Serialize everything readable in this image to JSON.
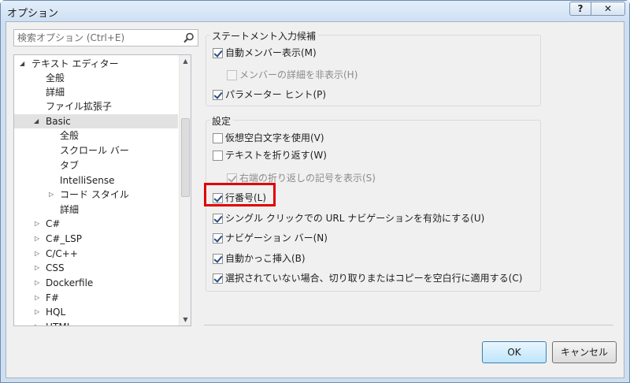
{
  "window": {
    "title": "オプション",
    "help_label": "?",
    "close_label": "✕"
  },
  "search": {
    "placeholder": "検索オプション (Ctrl+E)",
    "icon": "search-icon"
  },
  "tree": {
    "items": [
      {
        "label": "テキスト エディター",
        "expander": "expanded"
      },
      {
        "label": "全般"
      },
      {
        "label": "詳細"
      },
      {
        "label": "ファイル拡張子"
      },
      {
        "label": "Basic",
        "expander": "expanded",
        "selected": true
      },
      {
        "label": "全般"
      },
      {
        "label": "スクロール バー"
      },
      {
        "label": "タブ"
      },
      {
        "label": "IntelliSense"
      },
      {
        "label": "コード スタイル",
        "expander": "collapsed"
      },
      {
        "label": "詳細"
      },
      {
        "label": "C#",
        "expander": "collapsed"
      },
      {
        "label": "C#_LSP",
        "expander": "collapsed"
      },
      {
        "label": "C/C++",
        "expander": "collapsed"
      },
      {
        "label": "CSS",
        "expander": "collapsed"
      },
      {
        "label": "Dockerfile",
        "expander": "collapsed"
      },
      {
        "label": "F#",
        "expander": "collapsed"
      },
      {
        "label": "HQL",
        "expander": "collapsed"
      },
      {
        "label": "HTML",
        "expander": "collapsed"
      }
    ]
  },
  "statement_completion": {
    "title": "ステートメント入力候補",
    "options": [
      {
        "label": "自動メンバー表示(M)",
        "checked": true,
        "enabled": true
      },
      {
        "label": "メンバーの詳細を非表示(H)",
        "checked": false,
        "enabled": false
      },
      {
        "label": "パラメーター ヒント(P)",
        "checked": true,
        "enabled": true
      }
    ]
  },
  "settings": {
    "title": "設定",
    "options": [
      {
        "label": "仮想空白文字を使用(V)",
        "checked": false,
        "enabled": true
      },
      {
        "label": "テキストを折り返す(W)",
        "checked": false,
        "enabled": true
      },
      {
        "label": "右端の折り返しの記号を表示(S)",
        "checked": true,
        "enabled": false
      },
      {
        "label": "行番号(L)",
        "checked": true,
        "enabled": true,
        "highlighted": true
      },
      {
        "label": "シングル クリックでの URL ナビゲーションを有効にする(U)",
        "checked": true,
        "enabled": true
      },
      {
        "label": "ナビゲーション バー(N)",
        "checked": true,
        "enabled": true
      },
      {
        "label": "自動かっこ挿入(B)",
        "checked": true,
        "enabled": true
      },
      {
        "label": "選択されていない場合、切り取りまたはコピーを空白行に適用する(C)",
        "checked": true,
        "enabled": true
      }
    ]
  },
  "buttons": {
    "ok": "OK",
    "cancel": "キャンセル"
  },
  "colors": {
    "highlight_border": "#e00000",
    "checkmark": "#2b4d86"
  }
}
